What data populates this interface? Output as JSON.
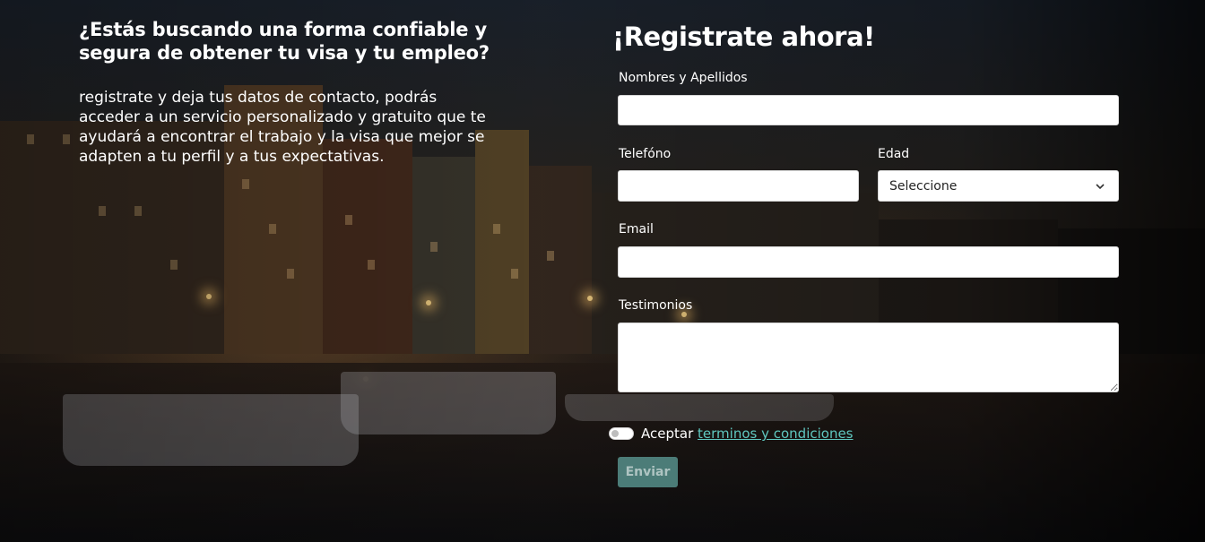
{
  "intro": {
    "heading": "¿Estás buscando una forma confiable y segura de obtener tu visa y tu empleo?",
    "body": "registrate y deja tus datos de contacto, podrás acceder a un servicio personalizado y gratuito que te ayudará a encontrar el trabajo y la visa que mejor se adapten a tu perfil y a tus expectativas."
  },
  "form": {
    "title": "¡Registrate ahora!",
    "name_label": "Nombres y Apellidos",
    "name_value": "",
    "phone_label": "Telefóno",
    "phone_value": "",
    "age_label": "Edad",
    "age_selected": "Seleccione",
    "email_label": "Email",
    "email_value": "",
    "testimonials_label": "Testimonios",
    "testimonials_value": "",
    "accept_prefix": "Aceptar",
    "terms_link": "terminos y condiciones",
    "submit_label": "Enviar"
  },
  "colors": {
    "accent": "#5fc7bf",
    "button": "#5fa09b"
  },
  "icons": {
    "select_arrow": "chevron-down-icon"
  }
}
